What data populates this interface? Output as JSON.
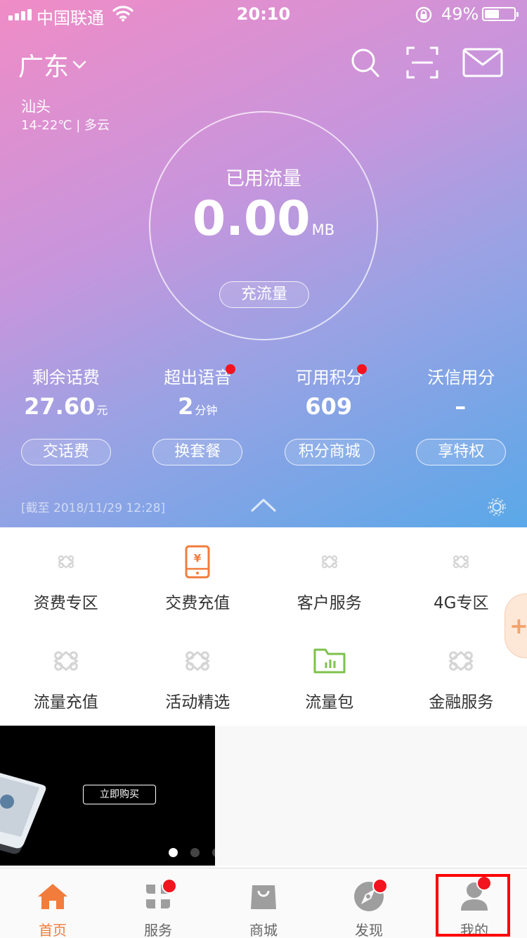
{
  "status_bar": {
    "carrier": "中国联通",
    "time": "20:10",
    "battery": "49%",
    "battery_level": 0.49
  },
  "header": {
    "region": "广东",
    "icons": [
      "search-icon",
      "scan-icon",
      "message-icon"
    ]
  },
  "weather": {
    "city": "汕头",
    "detail": "14-22℃ | 多云"
  },
  "data_usage": {
    "title": "已用流量",
    "value": "0.00",
    "unit": "MB",
    "button": "充流量"
  },
  "stats": [
    {
      "label": "剩余话费",
      "value": "27.60",
      "unit": "元",
      "button": "交话费",
      "dot": false
    },
    {
      "label": "超出语音",
      "value": "2",
      "unit": "分钟",
      "button": "换套餐",
      "dot": true
    },
    {
      "label": "可用积分",
      "value": "609",
      "unit": "",
      "button": "积分商城",
      "dot": true
    },
    {
      "label": "沃信用分",
      "value": "–",
      "unit": "",
      "button": "享特权",
      "dot": false
    }
  ],
  "as_of": "[截至 2018/11/29 12:28]",
  "services": [
    {
      "label": "资费专区",
      "icon": "unicom-logo-icon"
    },
    {
      "label": "交费充值",
      "icon": "phone-recharge-icon"
    },
    {
      "label": "客户服务",
      "icon": "unicom-logo-icon"
    },
    {
      "label": "4G专区",
      "icon": "unicom-logo-icon"
    },
    {
      "label": "流量充值",
      "icon": "unicom-logo-icon"
    },
    {
      "label": "活动精选",
      "icon": "unicom-logo-icon"
    },
    {
      "label": "流量包",
      "icon": "folder-chart-icon"
    },
    {
      "label": "金融服务",
      "icon": "unicom-logo-icon"
    }
  ],
  "banner": {
    "button": "立即购买"
  },
  "tabs": [
    {
      "label": "首页",
      "icon": "home-icon",
      "active": true,
      "dot": false
    },
    {
      "label": "服务",
      "icon": "clover-icon",
      "active": false,
      "dot": true
    },
    {
      "label": "商城",
      "icon": "shopping-bag-icon",
      "active": false,
      "dot": false
    },
    {
      "label": "发现",
      "icon": "compass-icon",
      "active": false,
      "dot": true
    },
    {
      "label": "我的",
      "icon": "user-icon",
      "active": false,
      "dot": true
    }
  ],
  "colors": {
    "accent": "#f27c3c",
    "badge": "#f2141e",
    "service_orange": "#f27c3c",
    "service_green": "#7dc24b",
    "logo_gray": "#cccccc"
  }
}
